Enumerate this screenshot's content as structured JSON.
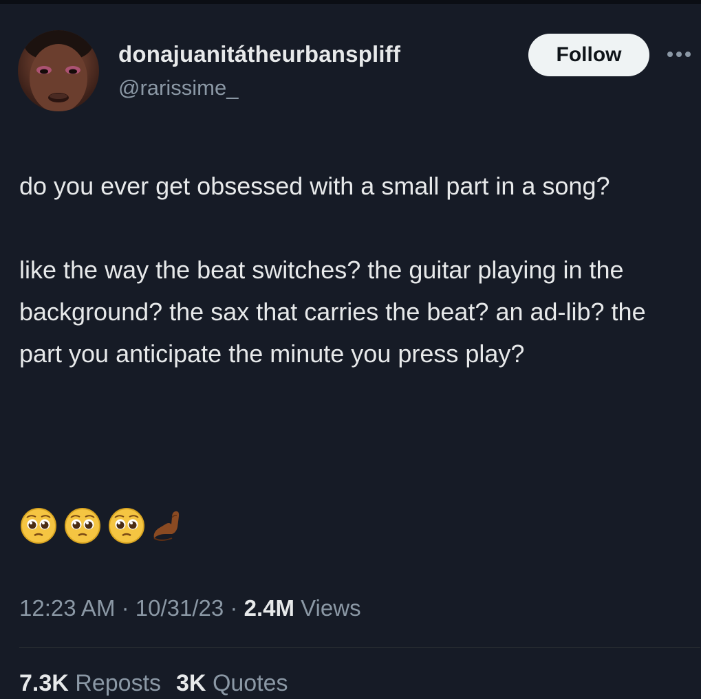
{
  "author": {
    "display_name": "donajuanitátheurbanspliff",
    "handle": "@rarissime_"
  },
  "actions": {
    "follow_label": "Follow"
  },
  "tweet": {
    "paragraph1": "do you ever get obsessed with a small part in a song?",
    "paragraph2": "like the way the beat switches? the guitar playing in the background? the sax that carries the beat? an ad-lib? the part you anticipate the minute you press play?",
    "emojis": [
      "pleading-face",
      "pleading-face",
      "pleading-face",
      "pinched-fingers-dark-skin"
    ]
  },
  "meta": {
    "time": "12:23 AM",
    "date": "10/31/23",
    "views_count": "2.4M",
    "views_label": "Views",
    "separator": "·"
  },
  "stats": {
    "reposts_count": "7.3K",
    "reposts_label": "Reposts",
    "quotes_count": "3K",
    "quotes_label": "Quotes"
  },
  "colors": {
    "background": "#161b26",
    "text_primary": "#e7e9ea",
    "text_secondary": "#8b98a5",
    "button_bg": "#eff3f4"
  }
}
